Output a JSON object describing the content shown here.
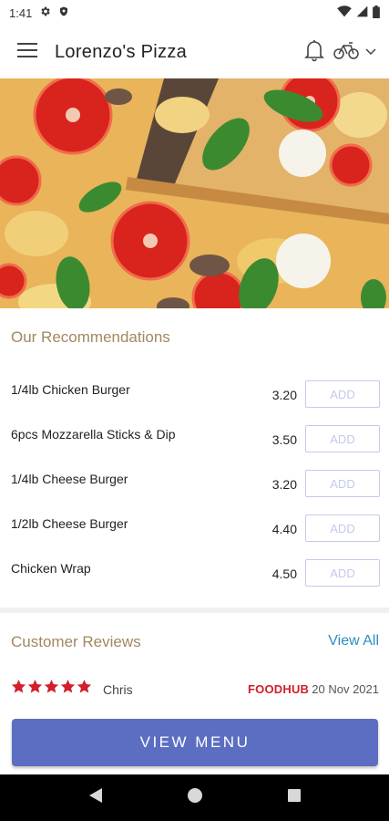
{
  "status_bar": {
    "time": "1:41",
    "left_icons": [
      "gear-icon",
      "shield-icon"
    ],
    "right_icons": [
      "wifi-icon",
      "signal-icon",
      "battery-icon"
    ]
  },
  "app_bar": {
    "title": "Lorenzo's Pizza",
    "icons": [
      "menu-icon",
      "bell-icon",
      "cycle-icon",
      "chevron-down-icon"
    ]
  },
  "recommendations": {
    "title": "Our Recommendations",
    "add_label": "ADD",
    "items": [
      {
        "name": "1/4lb Chicken Burger",
        "price": "3.20"
      },
      {
        "name": "6pcs Mozzarella Sticks & Dip",
        "price": "3.50"
      },
      {
        "name": "1/4lb Cheese Burger",
        "price": "3.20"
      },
      {
        "name": "1/2lb Cheese Burger",
        "price": "4.40"
      },
      {
        "name": "Chicken Wrap",
        "price": "4.50"
      }
    ]
  },
  "reviews": {
    "title": "Customer Reviews",
    "view_all": "View All",
    "items": [
      {
        "rating": 5,
        "max_rating": 5,
        "reviewer": "Chris",
        "source": "FOODHUB",
        "date": "20 Nov 2021"
      }
    ]
  },
  "cta": {
    "label": "VIEW MENU"
  },
  "nav_bar": {
    "buttons": [
      "back-icon",
      "home-icon",
      "recents-icon"
    ]
  },
  "colors": {
    "accent": "#5b6ec2",
    "section_title": "#a1885f",
    "link": "#2a8fc1",
    "star": "#d21f2a",
    "add_button_border": "#c5c9ec"
  }
}
